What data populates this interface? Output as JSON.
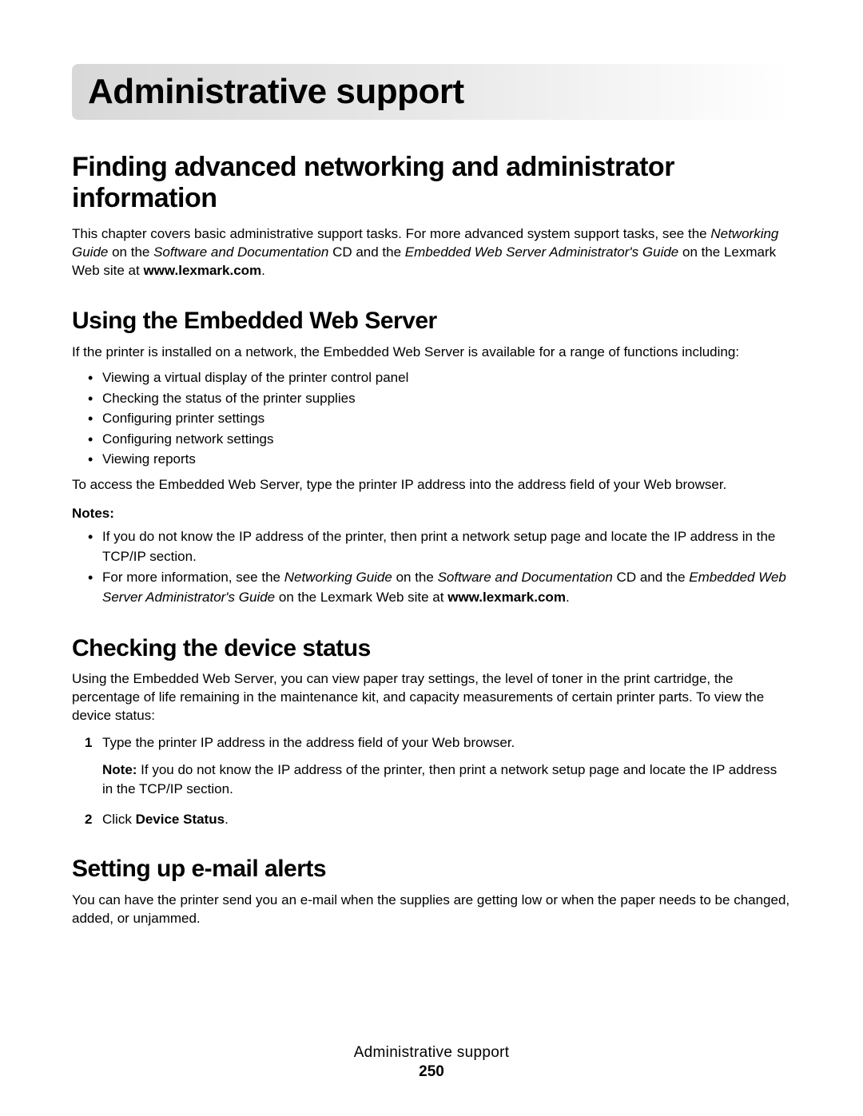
{
  "chapter_title": "Administrative support",
  "section1": {
    "heading": "Finding advanced networking and administrator information",
    "para_pre": "This chapter covers basic administrative support tasks. For more advanced system support tasks, see the ",
    "para_em1": "Networking Guide",
    "para_mid1": " on the ",
    "para_em2": "Software and Documentation",
    "para_mid2": " CD and the ",
    "para_em3": "Embedded Web Server Administrator's Guide",
    "para_mid3": " on the Lexmark Web site at ",
    "para_bold": "www.lexmark.com",
    "para_end": "."
  },
  "section2": {
    "heading": "Using the Embedded Web Server",
    "intro": "If the printer is installed on a network, the Embedded Web Server is available for a range of functions including:",
    "bullets": [
      "Viewing a virtual display of the printer control panel",
      "Checking the status of the printer supplies",
      "Configuring printer settings",
      "Configuring network settings",
      "Viewing reports"
    ],
    "after_bullets": "To access the Embedded Web Server, type the printer IP address into the address field of your Web browser.",
    "notes_label": "Notes:",
    "notes": {
      "n1": "If you do not know the IP address of the printer, then print a network setup page and locate the IP address in the TCP/IP section.",
      "n2_pre": "For more information, see the ",
      "n2_em1": "Networking Guide",
      "n2_mid1": " on the ",
      "n2_em2": "Software and Documentation",
      "n2_mid2": " CD and the ",
      "n2_em3": "Embedded Web Server Administrator's Guide",
      "n2_mid3": " on the Lexmark Web site at ",
      "n2_bold": "www.lexmark.com",
      "n2_end": "."
    }
  },
  "section3": {
    "heading": "Checking the device status",
    "intro": "Using the Embedded Web Server, you can view paper tray settings, the level of toner in the print cartridge, the percentage of life remaining in the maintenance kit, and capacity measurements of certain printer parts. To view the device status:",
    "steps": {
      "s1_num": "1",
      "s1_text": "Type the printer IP address in the address field of your Web browser.",
      "s1_note_label": "Note: ",
      "s1_note_text": "If you do not know the IP address of the printer, then print a network setup page and locate the IP address in the TCP/IP section.",
      "s2_num": "2",
      "s2_pre": "Click ",
      "s2_bold": "Device Status",
      "s2_end": "."
    }
  },
  "section4": {
    "heading": "Setting up e-mail alerts",
    "intro": "You can have the printer send you an e-mail when the supplies are getting low or when the paper needs to be changed, added, or unjammed."
  },
  "footer": {
    "title": "Administrative support",
    "page": "250"
  }
}
